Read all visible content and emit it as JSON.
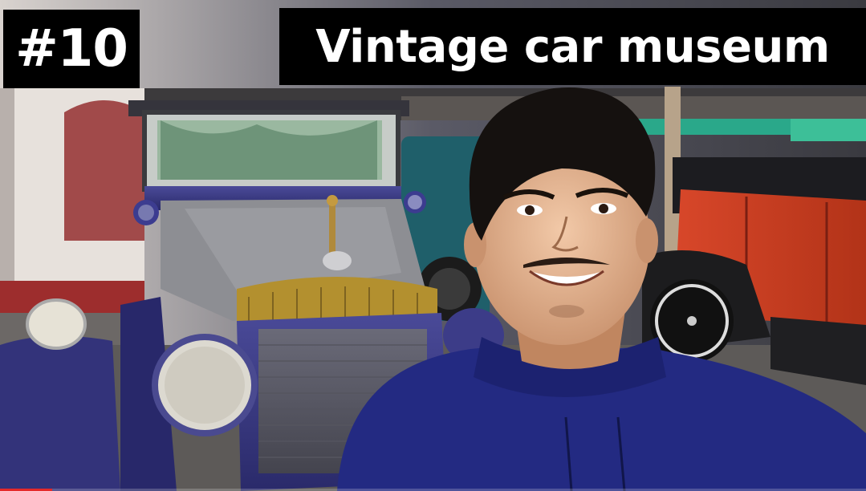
{
  "thumbnail": {
    "episode_badge": "#10",
    "title": "Vintage car museum"
  },
  "colors": {
    "caption_bg": "#000000",
    "caption_text": "#ffffff",
    "car_blue": "#3a3a86",
    "car_red": "#cc3a24",
    "hoodie": "#222a80"
  },
  "progress": {
    "fraction": 0.06
  }
}
